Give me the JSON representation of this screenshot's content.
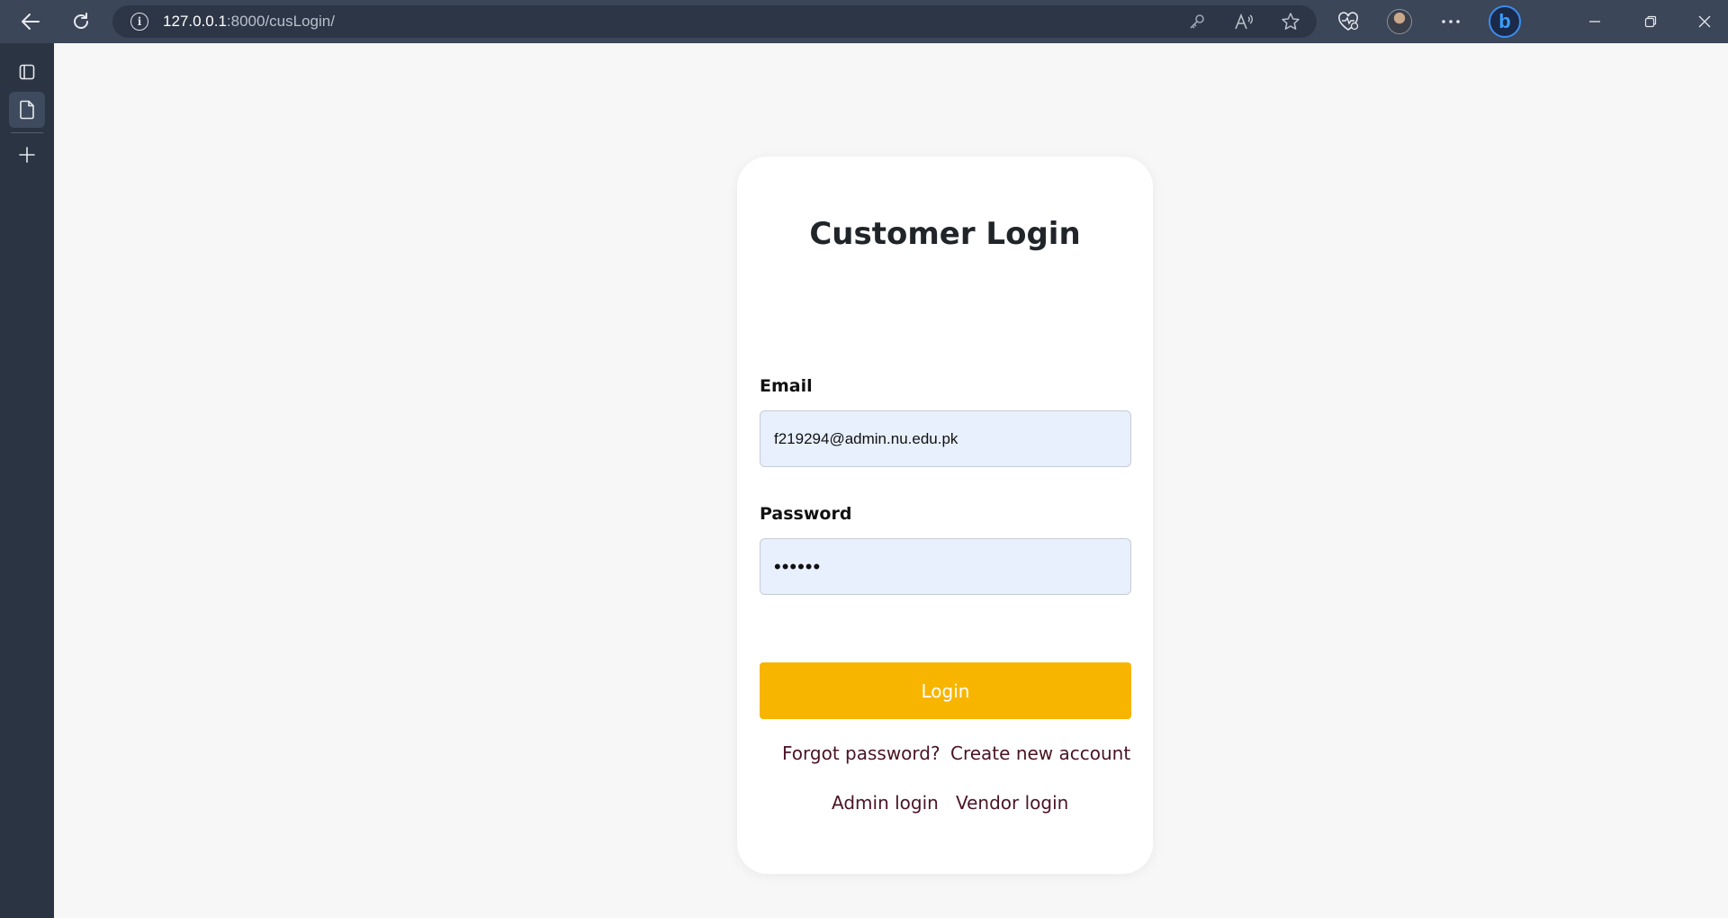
{
  "browser": {
    "url_host": "127.0.0.1",
    "url_path": ":8000/cusLogin/",
    "icons": [
      "back-arrow-icon",
      "reload-icon",
      "site-info-icon",
      "key-icon",
      "read-aloud-icon",
      "favorite-star-icon",
      "browser-essentials-icon",
      "profile-avatar",
      "more-options-icon",
      "bing-copilot-icon",
      "minimize-icon",
      "restore-icon",
      "close-icon"
    ],
    "window_controls": {
      "minimize": "—",
      "restore": "❐",
      "close": "✕"
    }
  },
  "sidebar": {
    "items": [
      "tab-actions-icon",
      "page-icon",
      "new-tab-plus-icon"
    ]
  },
  "login": {
    "title": "Customer Login",
    "email_label": "Email",
    "email_value": "f219294@admin.nu.edu.pk",
    "password_label": "Password",
    "password_value": "••••••",
    "login_button": "Login",
    "links": {
      "forgot_password": "Forgot password?",
      "create_account": "Create new account",
      "admin_login": "Admin login",
      "vendor_login": "Vendor login"
    }
  },
  "colors": {
    "accent": "#f8b500",
    "link": "#4a1424",
    "input_bg": "#e8f0fe",
    "chrome_bar": "#3b4658",
    "sidebar": "#2b3443"
  }
}
